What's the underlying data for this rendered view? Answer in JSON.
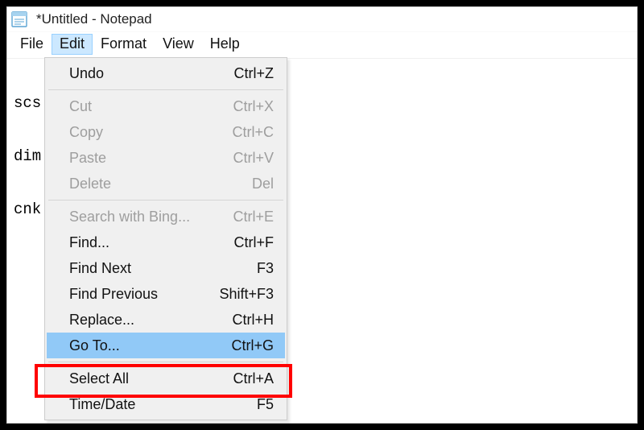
{
  "titlebar": {
    "text": "*Untitled - Notepad"
  },
  "menubar": {
    "items": [
      "File",
      "Edit",
      "Format",
      "View",
      "Help"
    ],
    "active_index": 1
  },
  "editor": {
    "lines": [
      "scs",
      "dim",
      "cnk"
    ]
  },
  "dropdown": {
    "items": [
      {
        "type": "item",
        "label": "Undo",
        "shortcut": "Ctrl+Z",
        "disabled": false,
        "highlight": false
      },
      {
        "type": "sep"
      },
      {
        "type": "item",
        "label": "Cut",
        "shortcut": "Ctrl+X",
        "disabled": true,
        "highlight": false
      },
      {
        "type": "item",
        "label": "Copy",
        "shortcut": "Ctrl+C",
        "disabled": true,
        "highlight": false
      },
      {
        "type": "item",
        "label": "Paste",
        "shortcut": "Ctrl+V",
        "disabled": true,
        "highlight": false
      },
      {
        "type": "item",
        "label": "Delete",
        "shortcut": "Del",
        "disabled": true,
        "highlight": false
      },
      {
        "type": "sep"
      },
      {
        "type": "item",
        "label": "Search with Bing...",
        "shortcut": "Ctrl+E",
        "disabled": true,
        "highlight": false
      },
      {
        "type": "item",
        "label": "Find...",
        "shortcut": "Ctrl+F",
        "disabled": false,
        "highlight": false
      },
      {
        "type": "item",
        "label": "Find Next",
        "shortcut": "F3",
        "disabled": false,
        "highlight": false
      },
      {
        "type": "item",
        "label": "Find Previous",
        "shortcut": "Shift+F3",
        "disabled": false,
        "highlight": false
      },
      {
        "type": "item",
        "label": "Replace...",
        "shortcut": "Ctrl+H",
        "disabled": false,
        "highlight": false
      },
      {
        "type": "item",
        "label": "Go To...",
        "shortcut": "Ctrl+G",
        "disabled": false,
        "highlight": true
      },
      {
        "type": "sep"
      },
      {
        "type": "item",
        "label": "Select All",
        "shortcut": "Ctrl+A",
        "disabled": false,
        "highlight": false
      },
      {
        "type": "item",
        "label": "Time/Date",
        "shortcut": "F5",
        "disabled": false,
        "highlight": false
      }
    ]
  }
}
